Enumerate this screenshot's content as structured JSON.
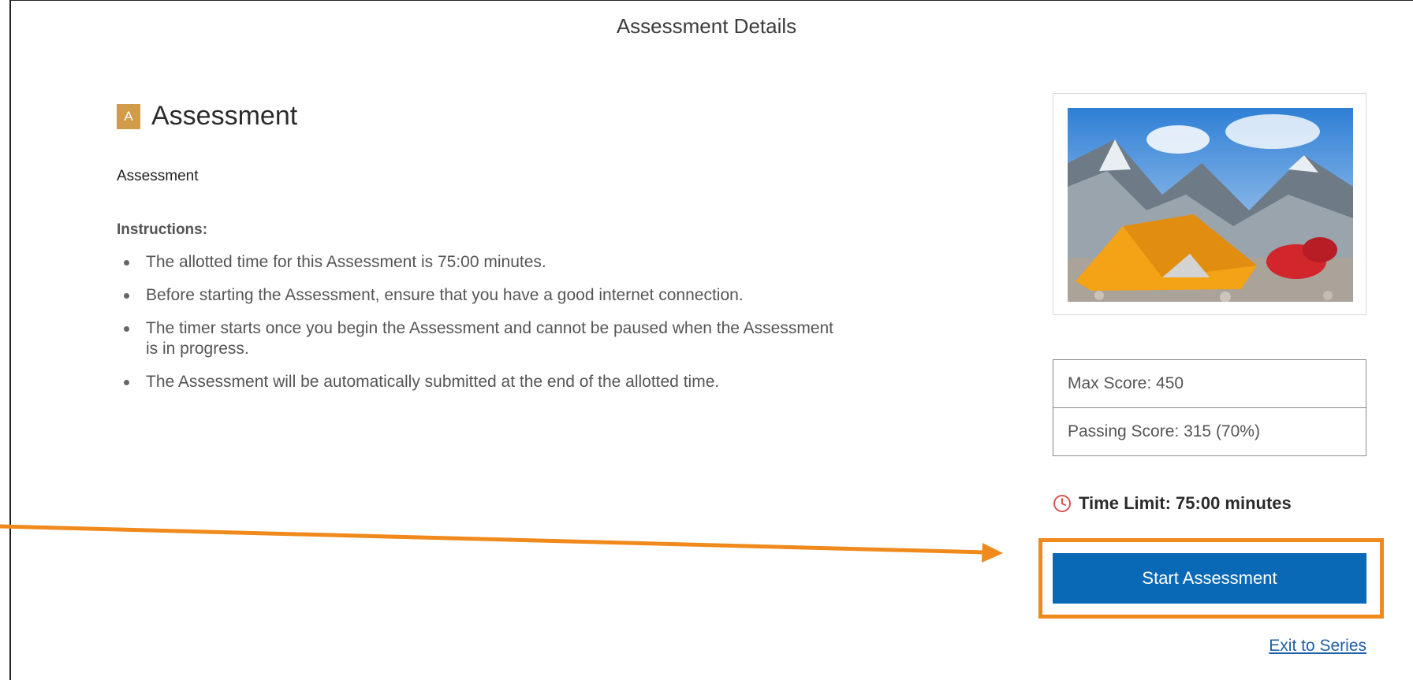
{
  "page": {
    "title": "Assessment Details"
  },
  "assessment": {
    "badge": "A",
    "heading": "Assessment",
    "subtitle": "Assessment",
    "instructions_label": "Instructions:",
    "instructions": [
      "The allotted time for this Assessment is 75:00 minutes.",
      "Before starting the Assessment, ensure that you have a good internet connection.",
      "The timer starts once you begin the Assessment and cannot be paused when the Assessment is in progress.",
      "The Assessment will be automatically submitted at the end of the allotted time."
    ]
  },
  "sidebar": {
    "thumbnail_icon": "mountain-tent-image",
    "max_score": "Max Score: 450",
    "passing_score": "Passing Score: 315 (70%)",
    "time_limit": "Time Limit: 75:00 minutes",
    "time_icon": "clock-icon",
    "start_label": "Start Assessment",
    "exit_label": "Exit to Series"
  },
  "colors": {
    "badge": "#d19b4a",
    "primary_button": "#0a69b6",
    "highlight": "#f08a1c",
    "clock": "#d9534f",
    "link": "#1f5fa8"
  }
}
